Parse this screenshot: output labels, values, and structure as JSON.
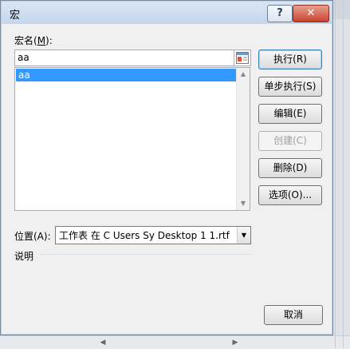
{
  "dialog": {
    "title": "宏",
    "help_label": "?",
    "close_label": "✕",
    "macro_name_label_prefix": "宏名(",
    "macro_name_label_key": "M",
    "macro_name_label_suffix": "):",
    "macro_name_value": "aa",
    "macro_list": [
      "aa"
    ],
    "buttons": {
      "run": "执行(R)",
      "step_into": "单步执行(S)",
      "edit": "编辑(E)",
      "create": "创建(C)",
      "delete": "删除(D)",
      "options": "选项(O)...",
      "cancel": "取消"
    },
    "location_label": "位置(A):",
    "location_value": "工作表 在 C  Users Sy Desktop 1 1.rtf",
    "description_label": "说明"
  }
}
